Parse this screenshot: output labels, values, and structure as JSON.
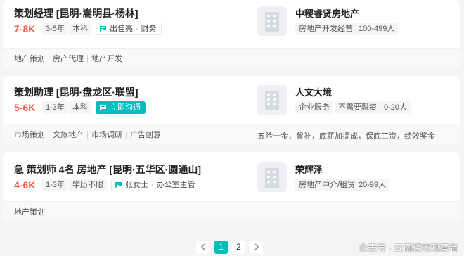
{
  "jobs": [
    {
      "title": "策划经理  [昆明·嵩明县·杨林]",
      "salary": "7-8K",
      "experience": "3-5年",
      "education": "本科",
      "recruiter_name": "出佳亮",
      "recruiter_role": "财务",
      "skills": [
        "地产策划",
        "房产代理",
        "地产开发"
      ],
      "company": "中稷睿贤房地产",
      "company_tags": [
        "房地产开发经营",
        "100-499人"
      ],
      "benefits": ""
    },
    {
      "title": "策划助理  [昆明·盘龙区·联盟]",
      "salary": "5-6K",
      "experience": "1-3年",
      "education": "本科",
      "chat_label": "立即沟通",
      "skills": [
        "市场策划",
        "文旅地产",
        "市场调研",
        "广告创意"
      ],
      "company": "人文大境",
      "company_tags": [
        "企业服务",
        "不需要融资",
        "0-20人"
      ],
      "benefits": "五险一金，餐补，底薪加提成，保底工资，绩效奖金"
    },
    {
      "title": "急 策划师 4名 房地产  [昆明·五华区·圆通山]",
      "salary": "4-6K",
      "experience": "1-3年",
      "education": "学历不限",
      "recruiter_name": "张女士",
      "recruiter_role": "办公室主管",
      "skills": [
        "地产策划"
      ],
      "company": "荣辉泽",
      "company_tags": [
        "房地产中介/租赁",
        "20-99人"
      ],
      "benefits": ""
    }
  ],
  "pagination": {
    "prev_icon": "chevron-left-icon",
    "pages": [
      "1",
      "2"
    ],
    "current": "1",
    "next_icon": "chevron-right-icon"
  },
  "watermark": "众表号 · 云南楼市观察者",
  "colors": {
    "salary": "#fe574a",
    "accent": "#00bebd",
    "background": "#f4f5f7"
  }
}
